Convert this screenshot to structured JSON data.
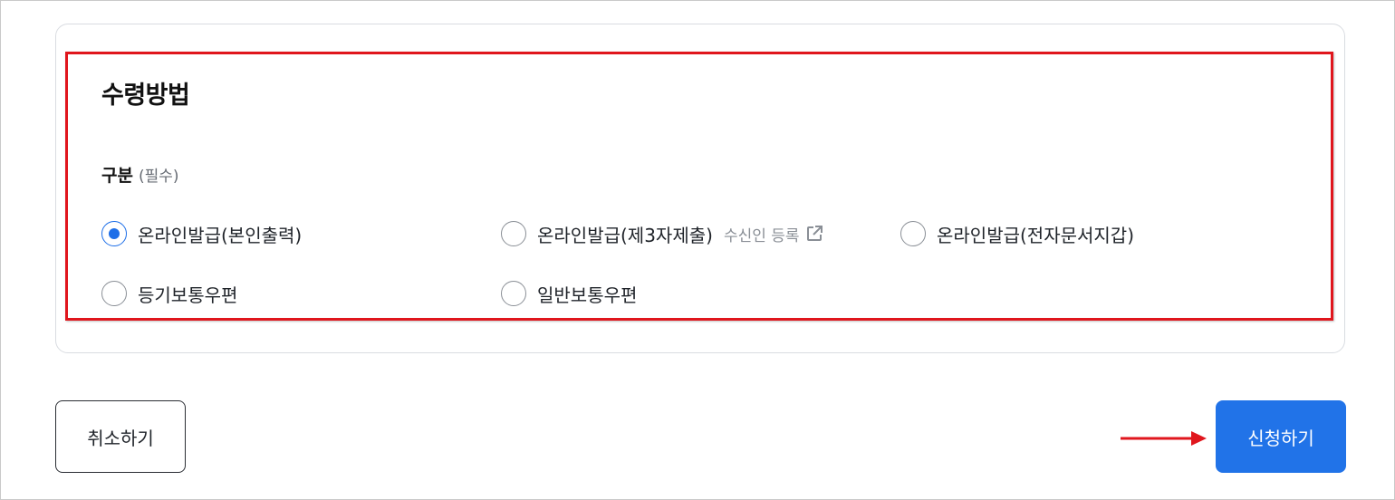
{
  "section": {
    "title": "수령방법",
    "group_label": "구분",
    "required_note": "(필수)"
  },
  "options": [
    {
      "label": "온라인발급(본인출력)",
      "checked": true
    },
    {
      "label": "온라인발급(제3자제출)",
      "checked": false,
      "link_label": "수신인 등록"
    },
    {
      "label": "온라인발급(전자문서지갑)",
      "checked": false
    },
    {
      "label": "등기보통우편",
      "checked": false
    },
    {
      "label": "일반보통우편",
      "checked": false
    }
  ],
  "actions": {
    "cancel_label": "취소하기",
    "submit_label": "신청하기"
  },
  "colors": {
    "accent": "#2173e8",
    "highlight": "#e0161d",
    "arrow": "#e0161d"
  },
  "icons": {
    "external_link": "external-link-icon",
    "arrow": "arrow-right-icon"
  }
}
